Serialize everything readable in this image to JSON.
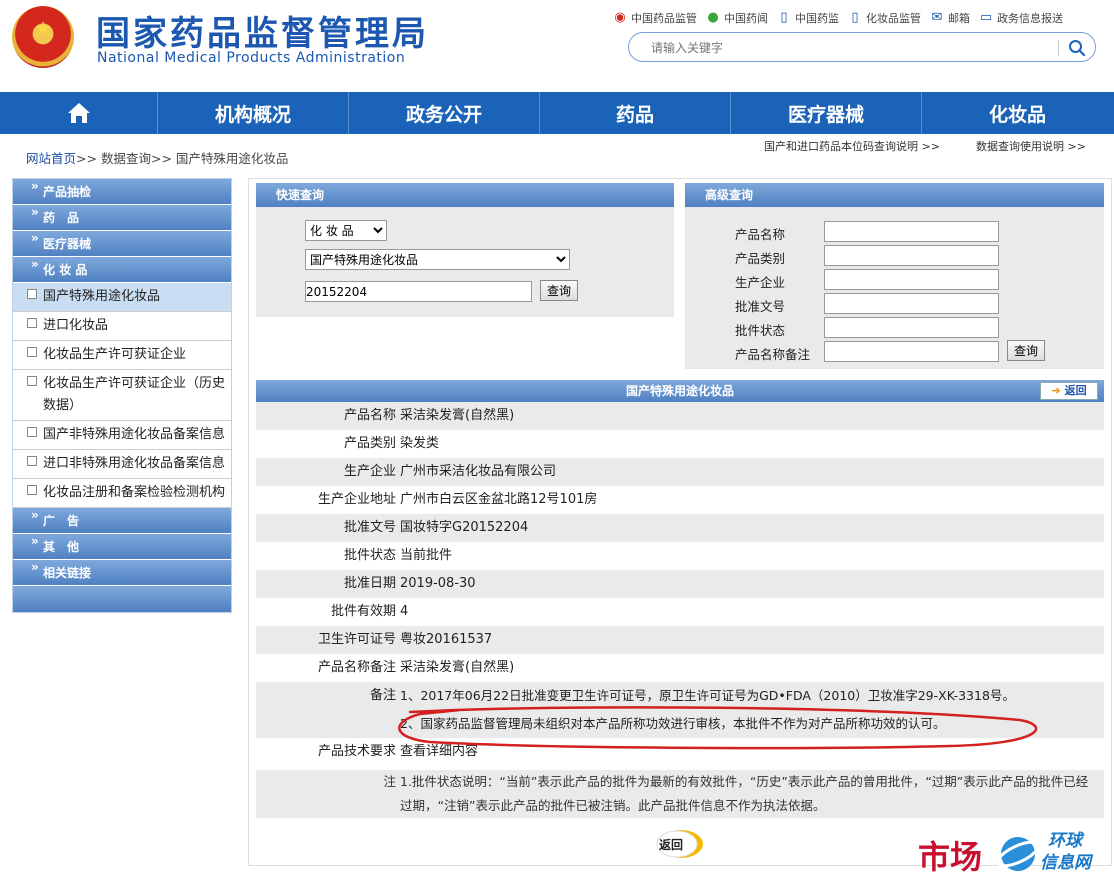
{
  "header": {
    "logo_cn": "国家药品监督管理局",
    "logo_en": "National Medical Products Administration",
    "top_links": [
      {
        "label": "中国药品监管",
        "icon": "weibo-icon"
      },
      {
        "label": "中国药闻",
        "icon": "wechat-icon"
      },
      {
        "label": "中国药监",
        "icon": "mobile-icon"
      },
      {
        "label": "化妆品监管",
        "icon": "mobile-icon"
      },
      {
        "label": "邮箱",
        "icon": "mail-icon"
      },
      {
        "label": "政务信息报送",
        "icon": "monitor-icon"
      }
    ],
    "search_placeholder": "请输入关键字"
  },
  "nav": {
    "items": [
      "机构概况",
      "政务公开",
      "药品",
      "医疗器械",
      "化妆品"
    ]
  },
  "breadcrumb": {
    "home": "网站首页",
    "sep": ">>",
    "level1": "数据查询",
    "level2": "国产特殊用途化妆品"
  },
  "top_right_links": {
    "link1": "国产和进口药品本位码查询说明 >>",
    "link2": "数据查询使用说明 >>"
  },
  "sidebar": {
    "heads": [
      "产品抽检",
      "药　品",
      "医疗器械",
      "化 妆 品"
    ],
    "subs": [
      "国产特殊用途化妆品",
      "进口化妆品",
      "化妆品生产许可获证企业",
      "化妆品生产许可获证企业（历史数据）",
      "国产非特殊用途化妆品备案信息",
      "进口非特殊用途化妆品备案信息",
      "化妆品注册和备案检验检测机构"
    ],
    "heads2": [
      "广　告",
      "其　他",
      "相关链接"
    ]
  },
  "quick": {
    "title": "快速查询",
    "category": "化 妆 品",
    "subcategory": "国产特殊用途化妆品",
    "keyword": "20152204",
    "button": "查询"
  },
  "advanced": {
    "title": "高级查询",
    "fields": [
      "产品名称",
      "产品类别",
      "生产企业",
      "批准文号",
      "批件状态",
      "产品名称备注"
    ],
    "button": "查询"
  },
  "detail": {
    "title": "国产特殊用途化妆品",
    "back": "返回",
    "rows": [
      {
        "k": "产品名称",
        "v": "采洁染发膏(自然黑)"
      },
      {
        "k": "产品类别",
        "v": "染发类"
      },
      {
        "k": "生产企业",
        "v": "广州市采洁化妆品有限公司"
      },
      {
        "k": "生产企业地址",
        "v": "广州市白云区金盆北路12号101房"
      },
      {
        "k": "批准文号",
        "v": "国妆特字G20152204"
      },
      {
        "k": "批件状态",
        "v": "当前批件"
      },
      {
        "k": "批准日期",
        "v": "2019-08-30"
      },
      {
        "k": "批件有效期",
        "v": "4"
      },
      {
        "k": "卫生许可证号",
        "v": "粤妆20161537"
      },
      {
        "k": "产品名称备注",
        "v": "采洁染发膏(自然黑)"
      }
    ],
    "remark_label": "备注",
    "remark_line1": "1、2017年06月22日批准变更卫生许可证号，原卫生许可证号为GD•FDA（2010）卫妆准字29-XK-3318号。",
    "remark_line2": "2、国家药品监督管理局未组织对本产品所称功效进行审核，本批件不作为对产品所称功效的认可。",
    "tech_label": "产品技术要求",
    "tech_value": "查看详细内容",
    "note_label": "注",
    "note_text": "1.批件状态说明：“当前”表示此产品的批件为最新的有效批件，“历史”表示此产品的曾用批件，“过期”表示此产品的批件已经过期，“注销”表示此产品的批件已被注销。此产品批件信息不作为执法依据。",
    "back_bottom": "返回"
  },
  "watermark": {
    "text1": "市场",
    "text2": "环球",
    "text3": "信息网"
  },
  "colors": {
    "brand_blue": "#1b63b8",
    "logo_blue": "#1c57b0",
    "panel_gray": "#eaeaea",
    "highlight_red": "#d42020"
  }
}
